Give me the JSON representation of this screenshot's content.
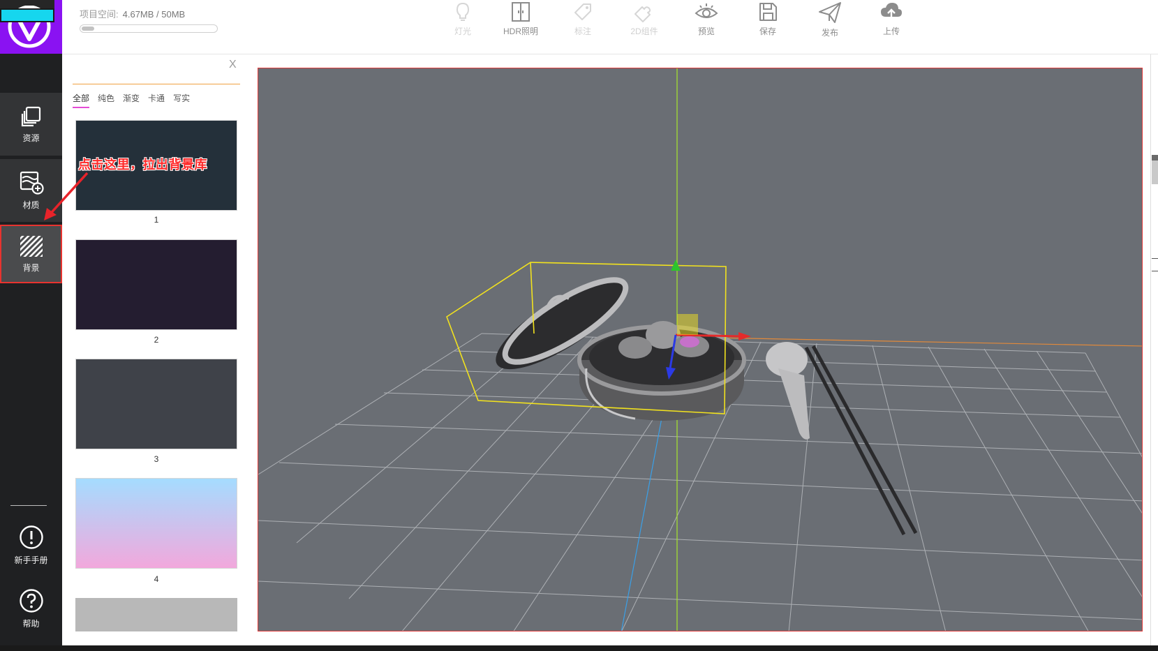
{
  "storage": {
    "label": "项目空间:",
    "value": "4.67MB / 50MB",
    "usage_fraction": 0.0934
  },
  "toolbar": [
    {
      "label": "灯光",
      "icon": "bulb-icon",
      "enabled": false
    },
    {
      "label": "HDR照明",
      "icon": "hdr-icon",
      "enabled": true
    },
    {
      "label": "标注",
      "icon": "tag-icon",
      "enabled": false
    },
    {
      "label": "2D组件",
      "icon": "puzzle-icon",
      "enabled": false
    },
    {
      "label": "预览",
      "icon": "eye-icon",
      "enabled": true
    },
    {
      "label": "保存",
      "icon": "save-icon",
      "enabled": true
    },
    {
      "label": "发布",
      "icon": "send-icon",
      "enabled": true
    },
    {
      "label": "上传",
      "icon": "cloud-upload-icon",
      "enabled": true
    }
  ],
  "sidebar": {
    "items": [
      {
        "label": "资源",
        "icon": "layers-icon"
      },
      {
        "label": "材质",
        "icon": "material-icon"
      },
      {
        "label": "背景",
        "icon": "stripes-icon",
        "selected": true
      }
    ],
    "bottom": [
      {
        "label": "新手手册",
        "icon": "exclamation-icon"
      },
      {
        "label": "帮助",
        "icon": "question-icon"
      }
    ]
  },
  "library": {
    "close_label": "X",
    "tabs": [
      "全部",
      "纯色",
      "渐变",
      "卡通",
      "写实"
    ],
    "active_tab": "全部",
    "backgrounds": [
      {
        "label": "1",
        "color": "#24303a"
      },
      {
        "label": "2",
        "color": "#241d30"
      },
      {
        "label": "3",
        "color": "#3f4249"
      },
      {
        "label": "4",
        "gradient": [
          "#a5dcff",
          "#f2a8dc"
        ]
      },
      {
        "label": "",
        "color": "#b8b8b8"
      }
    ]
  },
  "annotation": {
    "text": "点击这里，拉出背景库"
  },
  "colors": {
    "accent_purple": "#8a12f2",
    "sidebar_bg": "#1f2022",
    "viewport_bg": "#6a6e74",
    "highlight_red": "#e03a3a",
    "selection_yellow": "#f2e21e",
    "tab_underline": "#e54bd6"
  }
}
